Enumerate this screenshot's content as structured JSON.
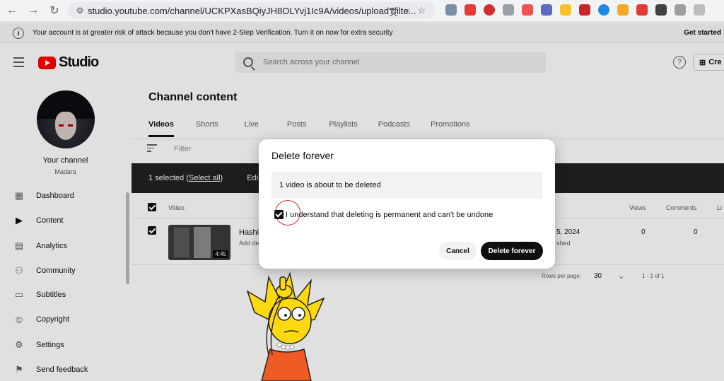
{
  "browser": {
    "url": "studio.youtube.com/channel/UCKPXasBQiyJH8OLYvj1Ic9A/videos/upload?filte..."
  },
  "banner": {
    "text": "Your account is at greater risk of attack because you don't have 2-Step Verification. Turn it on now for extra security",
    "cta": "Get started"
  },
  "header": {
    "logo_text": "Studio",
    "search_placeholder": "Search across your channel",
    "help": "?",
    "create_label": "Cre"
  },
  "sidebar": {
    "channel_name": "Your channel",
    "channel_handle": "Madara",
    "items": [
      {
        "label": "Dashboard",
        "icon": "dashboard-icon"
      },
      {
        "label": "Content",
        "icon": "content-icon"
      },
      {
        "label": "Analytics",
        "icon": "analytics-icon"
      },
      {
        "label": "Community",
        "icon": "community-icon"
      },
      {
        "label": "Subtitles",
        "icon": "subtitles-icon"
      },
      {
        "label": "Copyright",
        "icon": "copyright-icon"
      },
      {
        "label": "Settings",
        "icon": "settings-icon"
      },
      {
        "label": "Send feedback",
        "icon": "feedback-icon"
      }
    ]
  },
  "main": {
    "title": "Channel content",
    "tabs": [
      "Videos",
      "Shorts",
      "Live",
      "Posts",
      "Playlists",
      "Podcasts",
      "Promotions"
    ],
    "filter_label": "Filter",
    "selection": {
      "selected_text": "1 selected (",
      "select_all": "Select all",
      "close_paren": ")",
      "edit": "Edi"
    },
    "table_head": {
      "video": "Video",
      "views": "Views",
      "comments": "Comments",
      "likes": "Li"
    },
    "row": {
      "title": "Hashi",
      "desc": "Add de",
      "duration": "4:45",
      "date": "5, 2024",
      "status": "shed",
      "views": "0",
      "comments": "0"
    },
    "pager": {
      "rows_label": "Rows per page:",
      "rows_value": "30",
      "range": "1 - 1 of 1"
    }
  },
  "dialog": {
    "title": "Delete forever",
    "info": "1 video is about to be deleted",
    "confirm": "I understand that deleting is permanent and can't be undone",
    "cancel": "Cancel",
    "delete": "Delete forever"
  },
  "colors": {
    "brand_red": "#ff0000",
    "selection_bar": "#212121",
    "highlight_ring": "#d32f2f"
  }
}
